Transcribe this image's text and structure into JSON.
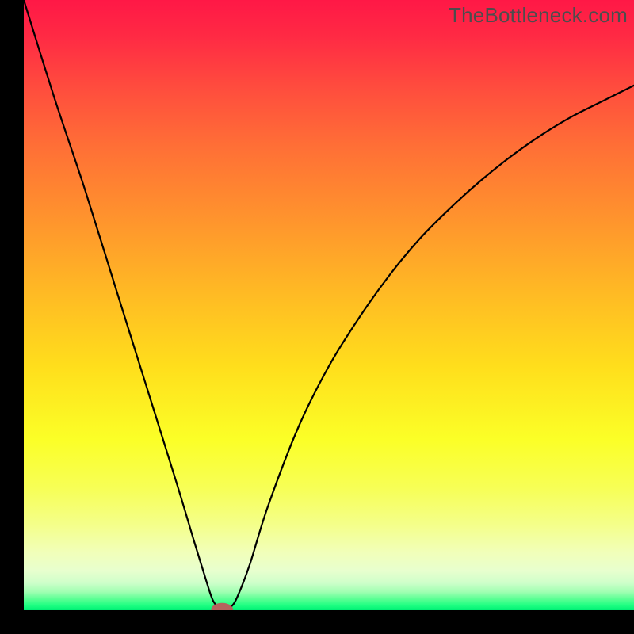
{
  "watermark": "TheBottleneck.com",
  "chart_data": {
    "type": "line",
    "title": "",
    "xlabel": "",
    "ylabel": "",
    "xlim": [
      0,
      100
    ],
    "ylim": [
      0,
      100
    ],
    "grid": false,
    "legend": false,
    "series": [
      {
        "name": "curve",
        "color": "#000000",
        "x": [
          0,
          5,
          10,
          15,
          20,
          25,
          28,
          30,
          31,
          32,
          33,
          34,
          35,
          37,
          40,
          45,
          50,
          55,
          60,
          65,
          70,
          75,
          80,
          85,
          90,
          95,
          100
        ],
        "y": [
          100,
          84,
          69,
          53,
          37,
          21,
          11,
          4.5,
          1.6,
          0.4,
          0.2,
          0.6,
          2.2,
          7.4,
          17,
          30,
          40,
          48,
          55,
          61,
          66,
          70.5,
          74.5,
          78,
          81,
          83.5,
          86
        ]
      }
    ],
    "marker": {
      "x": 32.5,
      "y": 0.1,
      "color": "#b5635d",
      "rx": 1.8,
      "ry": 1.1
    },
    "background_gradient": {
      "stops": [
        {
          "offset": 0.0,
          "color": "#ff1846"
        },
        {
          "offset": 0.06,
          "color": "#ff2a44"
        },
        {
          "offset": 0.14,
          "color": "#ff4b3e"
        },
        {
          "offset": 0.24,
          "color": "#ff6f36"
        },
        {
          "offset": 0.36,
          "color": "#ff942d"
        },
        {
          "offset": 0.48,
          "color": "#ffba24"
        },
        {
          "offset": 0.6,
          "color": "#ffde1c"
        },
        {
          "offset": 0.72,
          "color": "#fbff27"
        },
        {
          "offset": 0.8,
          "color": "#f7ff56"
        },
        {
          "offset": 0.86,
          "color": "#f4ff8a"
        },
        {
          "offset": 0.905,
          "color": "#f1ffb9"
        },
        {
          "offset": 0.935,
          "color": "#e8ffce"
        },
        {
          "offset": 0.955,
          "color": "#cfffca"
        },
        {
          "offset": 0.97,
          "color": "#a0ffb2"
        },
        {
          "offset": 0.982,
          "color": "#58ff93"
        },
        {
          "offset": 0.992,
          "color": "#1fff82"
        },
        {
          "offset": 1.0,
          "color": "#00ee75"
        }
      ]
    }
  }
}
